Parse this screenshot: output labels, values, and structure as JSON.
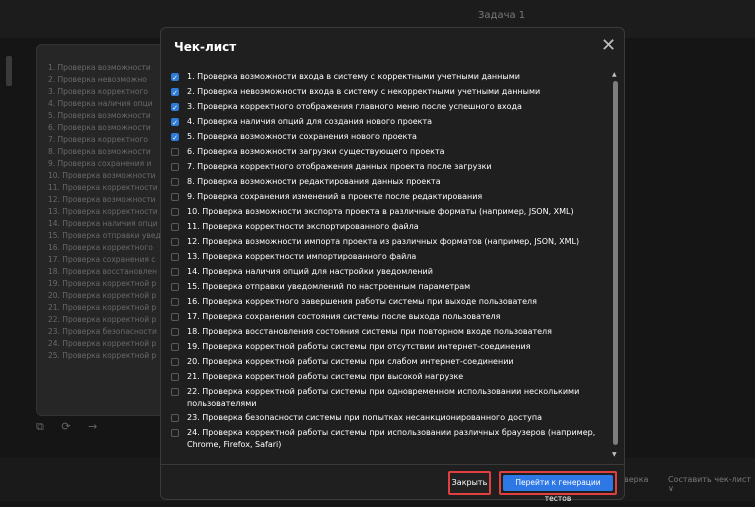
{
  "app": {
    "tab_title": "Задача 1"
  },
  "background_list": [
    "1. Проверка возможности",
    "2. Проверка невозможно",
    "3. Проверка корректного",
    "4. Проверка наличия опци",
    "5. Проверка возможности",
    "6. Проверка возможности",
    "7. Проверка корректного",
    "8. Проверка возможности",
    "9. Проверка сохранения и",
    "10. Проверка возможности",
    "11. Проверка корректности",
    "12. Проверка возможности",
    "13. Проверка корректности",
    "14. Проверка наличия опци",
    "15. Проверка отправки увед",
    "16. Проверка корректного",
    "17. Проверка сохранения с",
    "18. Проверка восстановлен",
    "19. Проверка корректной р",
    "20. Проверка корректной р",
    "21. Проверка корректной р",
    "22. Проверка корректной р",
    "23. Проверка безопасности",
    "24. Проверка корректной р",
    "25. Проверка корректной р"
  ],
  "background_bottom": {
    "left_label": "верка",
    "right_label": "Составить чек-лист ∨"
  },
  "icons": {
    "copy": "copy-icon",
    "refresh": "refresh-icon",
    "arrow": "arrow-right-icon"
  },
  "modal": {
    "title": "Чек-лист",
    "close_symbol": "✕",
    "close_button": "Закрыть",
    "go_button": "Перейти к генерации тестов",
    "items": [
      {
        "text": "1. Проверка возможности входа в систему с корректными учетными данными",
        "checked": true
      },
      {
        "text": "2. Проверка невозможности входа в систему с некорректными учетными данными",
        "checked": true
      },
      {
        "text": "3. Проверка корректного отображения главного меню после успешного входа",
        "checked": true
      },
      {
        "text": "4. Проверка наличия опций для создания нового проекта",
        "checked": true
      },
      {
        "text": "5. Проверка возможности сохранения нового проекта",
        "checked": true
      },
      {
        "text": "6. Проверка возможности загрузки существующего проекта",
        "checked": false
      },
      {
        "text": "7. Проверка корректного отображения данных проекта после загрузки",
        "checked": false
      },
      {
        "text": "8. Проверка возможности редактирования данных проекта",
        "checked": false
      },
      {
        "text": "9. Проверка сохранения изменений в проекте после редактирования",
        "checked": false
      },
      {
        "text": "10. Проверка возможности экспорта проекта в различные форматы (например, JSON, XML)",
        "checked": false
      },
      {
        "text": "11. Проверка корректности экспортированного файла",
        "checked": false
      },
      {
        "text": "12. Проверка возможности импорта проекта из различных форматов (например, JSON, XML)",
        "checked": false
      },
      {
        "text": "13. Проверка корректности импортированного файла",
        "checked": false
      },
      {
        "text": "14. Проверка наличия опций для настройки уведомлений",
        "checked": false
      },
      {
        "text": "15. Проверка отправки уведомлений по настроенным параметрам",
        "checked": false
      },
      {
        "text": "16. Проверка корректного завершения работы системы при выходе пользователя",
        "checked": false
      },
      {
        "text": "17. Проверка сохранения состояния системы после выхода пользователя",
        "checked": false
      },
      {
        "text": "18. Проверка восстановления состояния системы при повторном входе пользователя",
        "checked": false
      },
      {
        "text": "19. Проверка корректной работы системы при отсутствии интернет-соединения",
        "checked": false
      },
      {
        "text": "20. Проверка корректной работы системы при слабом интернет-соединении",
        "checked": false
      },
      {
        "text": "21. Проверка корректной работы системы при высокой нагрузке",
        "checked": false
      },
      {
        "text": "22. Проверка корректной работы системы при одновременном использовании несколькими пользователями",
        "checked": false
      },
      {
        "text": "23. Проверка безопасности системы при попытках несанкционированного доступа",
        "checked": false
      },
      {
        "text": "24. Проверка корректной работы системы при использовании различных браузеров (например, Chrome, Firefox, Safari)",
        "checked": false
      }
    ]
  }
}
